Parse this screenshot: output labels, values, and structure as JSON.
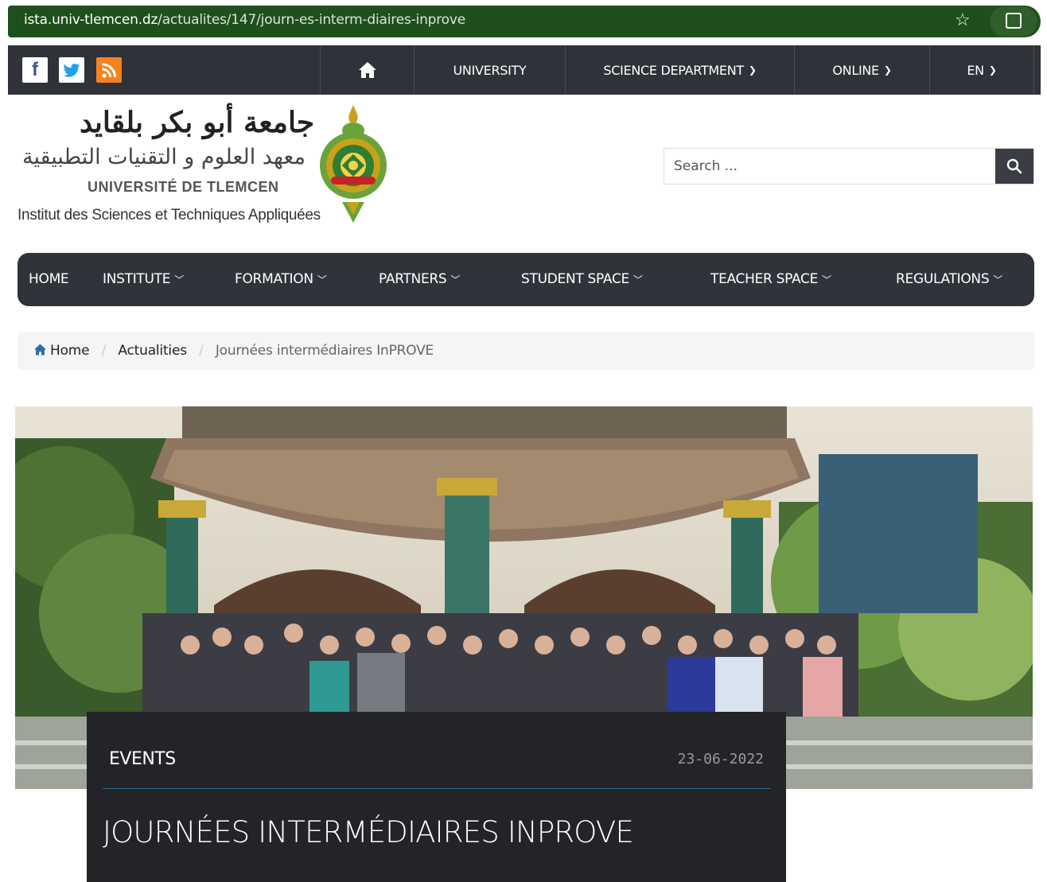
{
  "browser": {
    "url_host": "ista.univ-tlemcen.dz",
    "url_path": "/actualites/147/journ-es-interm-diaires-inprove",
    "star_icon": "bookmark-star-icon",
    "extension_icon": "extensions-puzzle-icon"
  },
  "topbar": {
    "social": [
      {
        "icon": "facebook-icon",
        "glyph": "f"
      },
      {
        "icon": "twitter-icon",
        "glyph": "🐦"
      },
      {
        "icon": "rss-icon",
        "glyph": "≈"
      }
    ],
    "nav": [
      {
        "label": "",
        "icon": "home-icon"
      },
      {
        "label": "UNIVERSITY"
      },
      {
        "label": "SCIENCE DEPARTMENT"
      },
      {
        "label": "ONLINE"
      },
      {
        "label": "EN"
      }
    ]
  },
  "logo": {
    "arabic_title": "جامعة أبو بكر بلقايد",
    "arabic_subtitle": "معهد العلوم و التقنيات التطبيقية",
    "french_university": "UNIVERSITÉ DE TLEMCEN",
    "french_institute": "Institut des Sciences et Techniques Appliquées"
  },
  "search": {
    "placeholder": "Search ...",
    "button_icon": "search-icon"
  },
  "mainnav": {
    "items": [
      {
        "label": "HOME",
        "dropdown": false
      },
      {
        "label": "INSTITUTE",
        "dropdown": true
      },
      {
        "label": "FORMATION",
        "dropdown": true
      },
      {
        "label": "PARTNERS",
        "dropdown": true
      },
      {
        "label": "STUDENT SPACE",
        "dropdown": true
      },
      {
        "label": "TEACHER SPACE",
        "dropdown": true
      },
      {
        "label": "REGULATIONS",
        "dropdown": true
      }
    ]
  },
  "breadcrumb": {
    "home": "Home",
    "section": "Actualities",
    "current": "Journées intermédiaires InPROVE"
  },
  "article": {
    "category": "EVENTS",
    "date": "23-06-2022",
    "title": "JOURNÉES INTERMÉDIAIRES INPROVE"
  },
  "colors": {
    "browser_bar": "#1f4f1c",
    "topbar": "#2f3238",
    "mainnav": "#30343a",
    "card": "#232427",
    "card_rule": "#2d6f8a",
    "rss": "#f58220"
  }
}
